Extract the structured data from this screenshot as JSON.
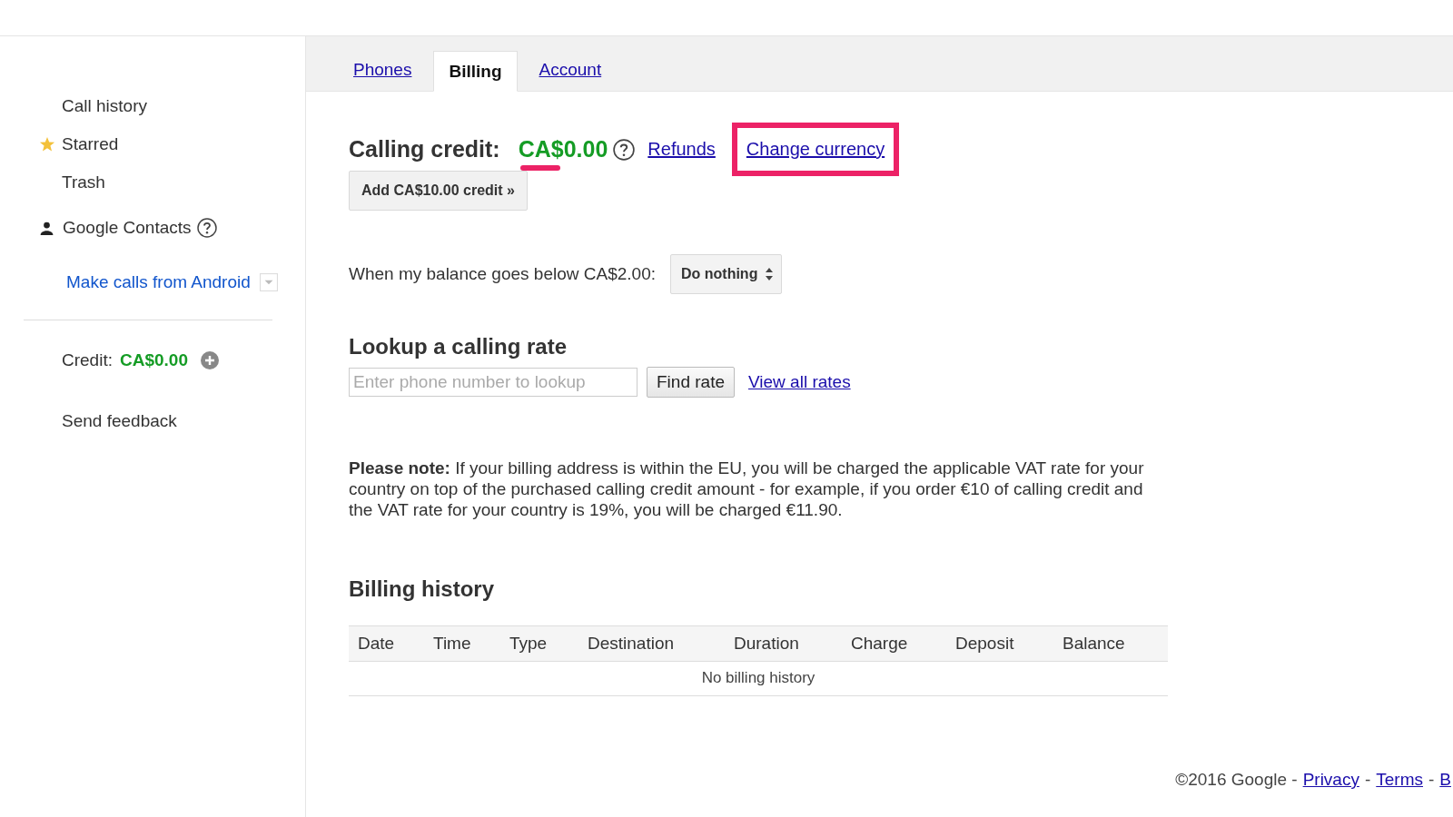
{
  "sidebar": {
    "items": [
      {
        "label": "Call history",
        "starred": false
      },
      {
        "label": "Starred",
        "starred": true
      },
      {
        "label": "Trash",
        "starred": false
      }
    ],
    "contacts": {
      "label": "Google Contacts"
    },
    "android_link": "Make calls from Android",
    "credit": {
      "label": "Credit:",
      "amount": "CA$0.00"
    },
    "feedback": "Send feedback"
  },
  "tabs": [
    {
      "label": "Phones",
      "selected": false
    },
    {
      "label": "Billing",
      "selected": true
    },
    {
      "label": "Account",
      "selected": false
    }
  ],
  "billing": {
    "credit_label": "Calling credit:",
    "credit_amount": "CA$0.00",
    "amount_underlined": true,
    "links": [
      {
        "label": "Refunds",
        "highlighted": false
      },
      {
        "label": "Change currency",
        "highlighted": true
      }
    ],
    "add_button": "Add CA$10.00 credit »",
    "balance_label": "When my balance goes below CA$2.00:",
    "balance_action": "Do nothing",
    "lookup_title": "Lookup a calling rate",
    "lookup_placeholder": "Enter phone number to lookup",
    "find_button": "Find rate",
    "view_rates": "View all rates",
    "note": "**Please note:** If your billing address is within the EU, you will be charged the applicable VAT rate for your country on top of the purchased calling credit amount - for example, if you order €10 of calling credit and the VAT rate for your country is 19%, you will be charged €11.90.",
    "history_title": "Billing history",
    "table": {
      "columns": [
        "Date",
        "Time",
        "Type",
        "Destination",
        "Duration",
        "Charge",
        "Deposit",
        "Balance"
      ],
      "empty": "No billing history"
    }
  },
  "footer": {
    "copyright": "©2016 Google -",
    "links": [
      {
        "kind": "link",
        "text": "Privacy"
      },
      {
        "kind": "separator",
        "text": "-"
      },
      {
        "kind": "link",
        "text": "Terms"
      },
      {
        "kind": "separator",
        "text": "-"
      },
      {
        "kind": "link",
        "text": "B"
      }
    ]
  }
}
